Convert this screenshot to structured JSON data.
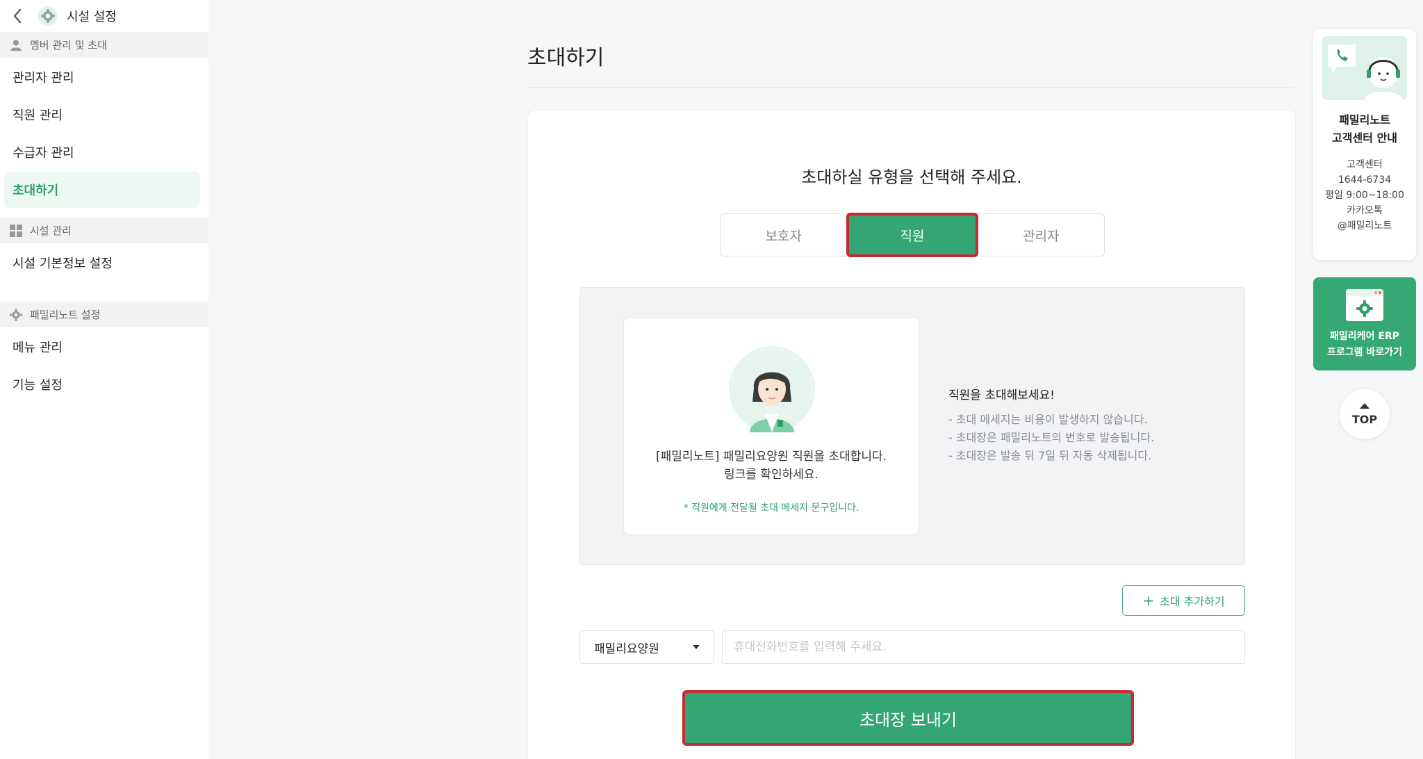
{
  "sidebar": {
    "header_title": "시설 설정",
    "section1": "멤버 관리 및 초대",
    "items1": [
      "관리자 관리",
      "직원 관리",
      "수급자 관리",
      "초대하기"
    ],
    "section2": "시설 관리",
    "items2": [
      "시설 기본정보 설정"
    ],
    "section3": "패밀리노트 설정",
    "items3": [
      "메뉴 관리",
      "기능 설정"
    ],
    "active_item": "초대하기"
  },
  "main": {
    "title": "초대하기",
    "prompt": "초대하실 유형을 선택해 주세요.",
    "tabs": [
      "보호자",
      "직원",
      "관리자"
    ],
    "active_tab": "직원",
    "preview": {
      "message_line1": "[패밀리노트] 패밀리요양원 직원을 초대합니다.",
      "message_line2": "링크를 확인하세요.",
      "note": "* 직원에게 전달될 초대 메세지 문구입니다.",
      "info_title": "직원을 초대해보세요!",
      "info_lines": [
        "- 초대 메세지는 비용이 발생하지 않습니다.",
        "- 초대장은 패밀리노트의 번호로 발송됩니다.",
        "- 초대장은 발송 뒤 7일 뒤 자동 삭제됩니다."
      ]
    },
    "add_button": "초대 추가하기",
    "facility_select": "패밀리요양원",
    "phone_placeholder": "휴대전화번호를 입력해 주세요.",
    "send_button": "초대장 보내기"
  },
  "right": {
    "cs_title_line1": "패밀리노트",
    "cs_title_line2": "고객센터 안내",
    "cs_info": [
      "고객센터",
      "1644-6734",
      "평일 9:00~18:00",
      "카카오톡",
      "@패밀리노트"
    ],
    "erp_line1": "패밀리케어 ERP",
    "erp_line2": "프로그램 바로가기",
    "top_label": "TOP"
  },
  "colors": {
    "accent": "#33a673",
    "highlight_border": "#c52b30"
  }
}
